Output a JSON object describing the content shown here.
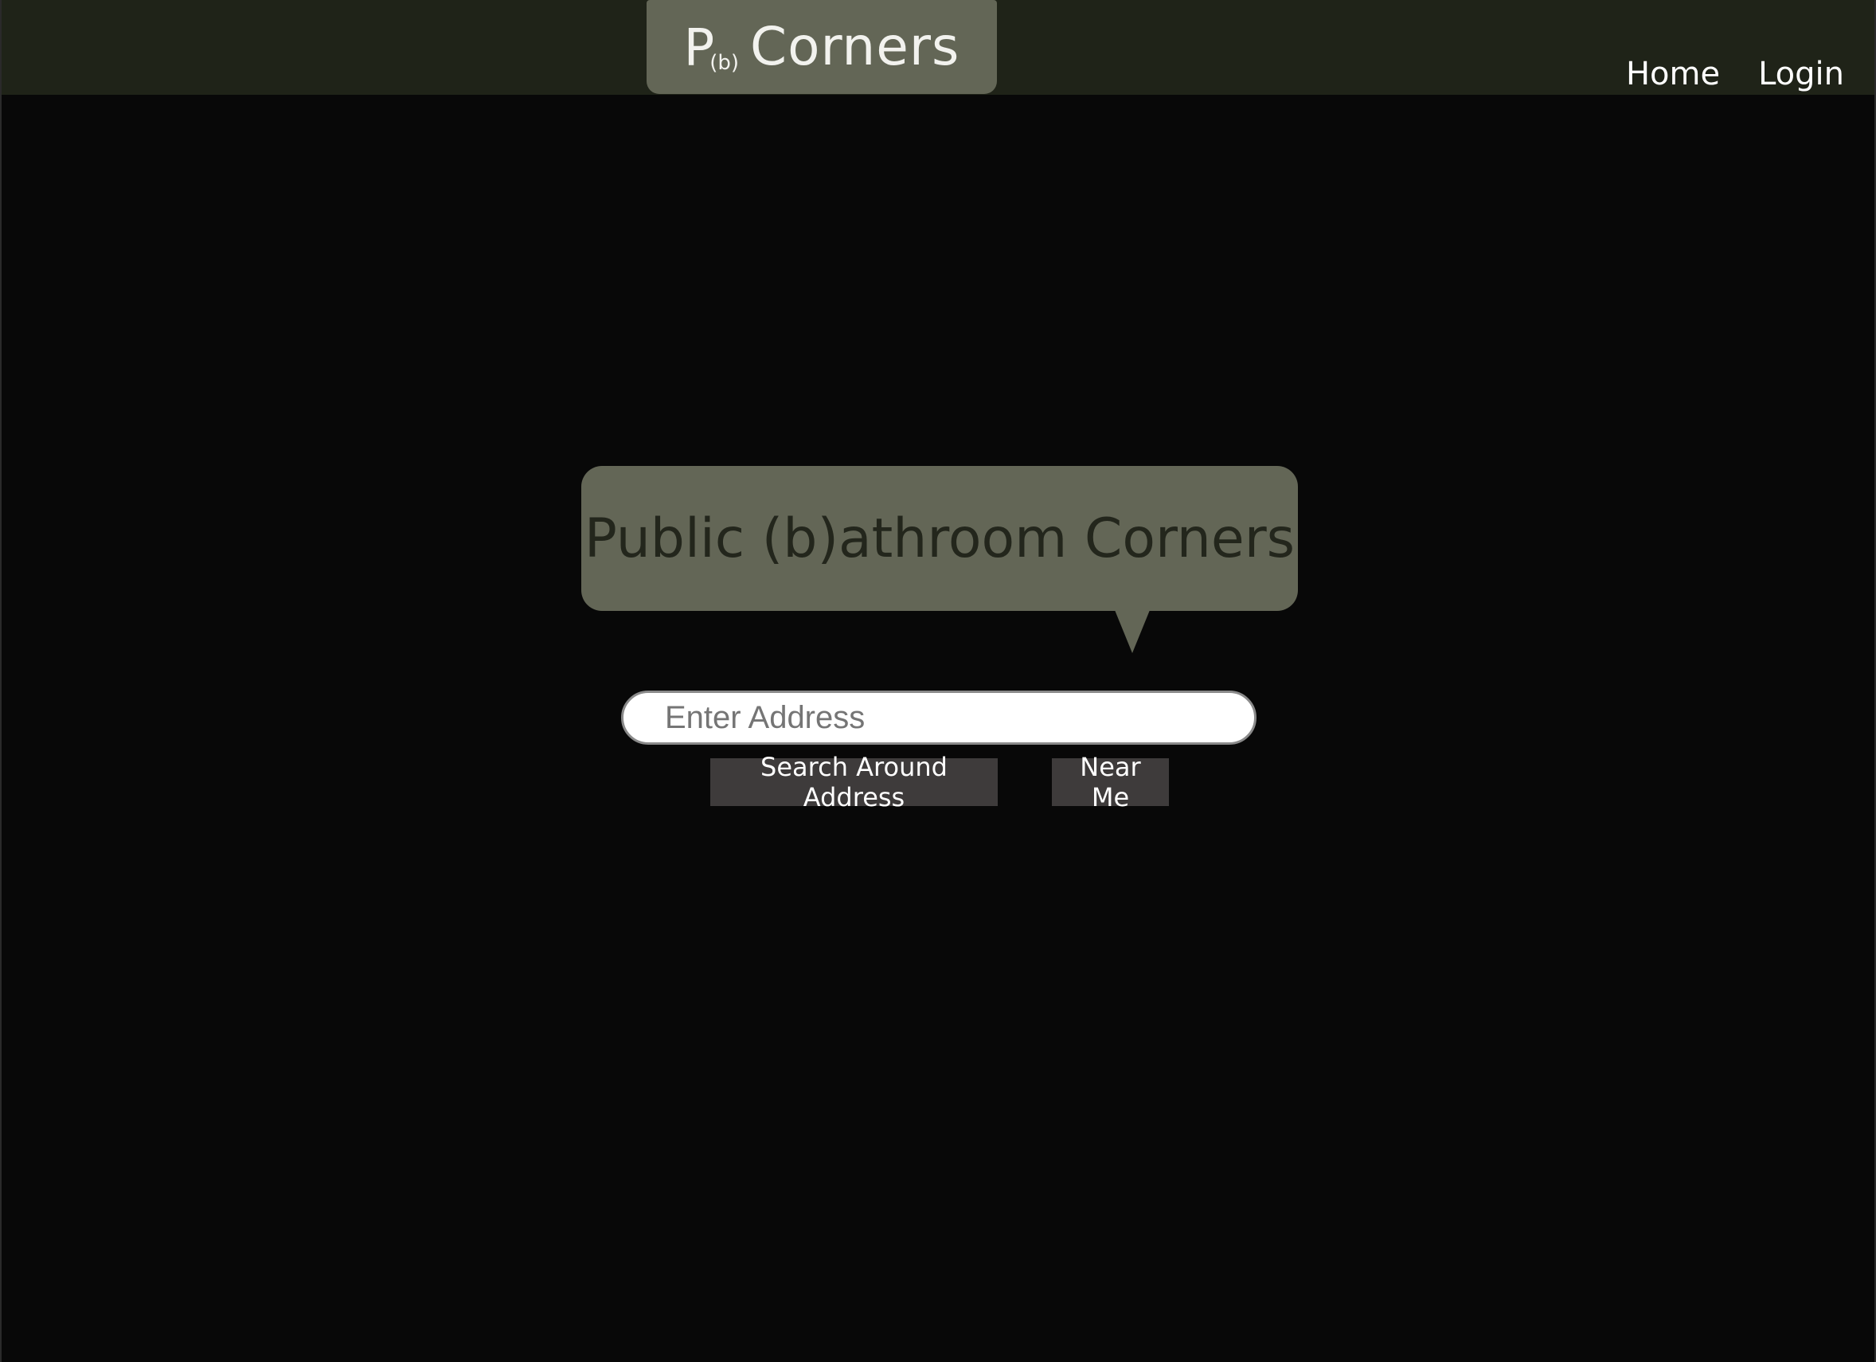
{
  "header": {
    "logo": {
      "p": "P",
      "b": "(b)",
      "word": "Corners"
    },
    "nav": [
      {
        "label": "Home"
      },
      {
        "label": "Login"
      }
    ]
  },
  "hero": {
    "title": "Public (b)athroom Corners"
  },
  "search": {
    "placeholder": "Enter Address",
    "value": "",
    "search_button": "Search Around Address",
    "near_me_button": "Near Me"
  },
  "colors": {
    "page_background": "#080808",
    "navbar_background": "#1f2318",
    "accent_box": "#636656",
    "title_text": "#23261c",
    "button_background": "#3e3b3b"
  }
}
